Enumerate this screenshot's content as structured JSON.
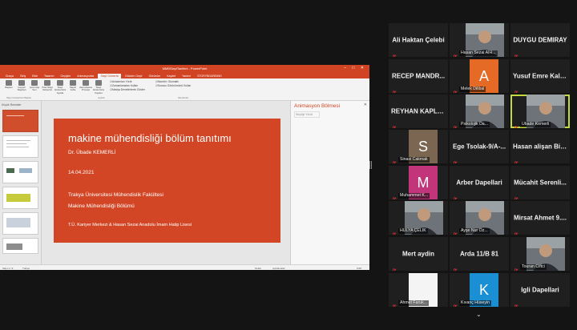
{
  "app": {
    "title": "MMBSlaytTanitimi - PowerPoint",
    "tabs": [
      "Dosya",
      "Giriş",
      "Ekle",
      "Tasarım",
      "Geçişler",
      "Animasyonlar",
      "Slayt Gösterisi",
      "Gözden Geçir",
      "Görünüm",
      "Kaydet",
      "Yardım",
      "STORYBOARDING"
    ],
    "active_tab": "Slayt Gösterisi",
    "search": "Ne yapmak istediğinizi söyleyin",
    "user": "Cihanno Ay",
    "share": "Paylaş"
  },
  "ribbon": {
    "buttons": [
      "Baştan",
      "Geçerli Slayttan",
      "Çevrimiçi Sun",
      "Özel Slayt Gösterisi",
      "Slayt Gösterisini Ayarla",
      "Slaydı Gizle",
      "Zamanlama Provası",
      "Slayt Gösterisini Kaydet"
    ],
    "checks": [
      "Anlatımları Yürüt",
      "Zamanlamaları Kullan",
      "Medya Denetimlerini Göster"
    ],
    "monitor": [
      "Monitör: Otomatik",
      "Sunucu Görünümünü Kullan"
    ],
    "groups": [
      "Slayt Gösterisini Başlat",
      "Ayarla",
      "Monitörler"
    ]
  },
  "thumbs_header": "Küçük Resimler",
  "slide": {
    "title": "makine mühendisliği bölüm tanıtımı",
    "author": "Dr. Übade KEMERLİ",
    "date": "14.04.2021",
    "institution": "Trakya Üniversitesi Mühendislik Fakültesi",
    "department": "Makine Mühendisliği Bölümü",
    "org": "T.Ü. Kariyer Merkezi & Hasan Sezai Anadolu İmam Hatip Lisesi"
  },
  "animation_pane": {
    "title": "Animasyon Bölmesi",
    "play": "Seçiliyi Yürüt"
  },
  "status": {
    "slide": "Slayt 1 / 9",
    "lang": "Türkçe",
    "notes": "Notlar",
    "comments": "Açıklamalar",
    "zoom": "%48"
  },
  "colors": {
    "accent": "#d04423",
    "speaker_outline": "#c4d93c",
    "background": "#141414"
  },
  "participants": [
    {
      "name": "Ali Haktan Çelebi",
      "kind": "name"
    },
    {
      "name": "Hasan Sezai AİH...",
      "kind": "video"
    },
    {
      "name": "DUYGU DEMIRAY",
      "kind": "name"
    },
    {
      "name": "RECEP MANDR...",
      "kind": "name"
    },
    {
      "name": "Melek Dilibal",
      "kind": "avatar",
      "initial": "A",
      "color": "#e46a25"
    },
    {
      "name": "Yusuf Emre Kalk...",
      "kind": "name"
    },
    {
      "name": "REYHAN KAPLAN",
      "kind": "name"
    },
    {
      "name": "Psikolojik Da...",
      "kind": "video"
    },
    {
      "name": "Übade Kemerli",
      "kind": "video",
      "speaking": true
    },
    {
      "name": "Sinasi Cakmak",
      "kind": "avatar",
      "initial": "S",
      "color": "#7b6651"
    },
    {
      "name": "Ege Tsolak-9/A-...",
      "kind": "name"
    },
    {
      "name": "Hasan alişan Bil...",
      "kind": "name"
    },
    {
      "name": "Muhammet K...",
      "kind": "avatar",
      "initial": "M",
      "color": "#c3357a"
    },
    {
      "name": "Arber Dapellari",
      "kind": "name"
    },
    {
      "name": "Mücahit Serenli...",
      "kind": "name"
    },
    {
      "name": "HULYA ÇELİK",
      "kind": "video"
    },
    {
      "name": "Ayşe Nur Öz...",
      "kind": "video"
    },
    {
      "name": "Mirsat Ahmet 9....",
      "kind": "name"
    },
    {
      "name": "Mert aydin",
      "kind": "name"
    },
    {
      "name": "Arda 11/B 81",
      "kind": "name"
    },
    {
      "name": "Touran Ciftci",
      "kind": "video"
    },
    {
      "name": "Ahmet Faruk...",
      "kind": "avatar",
      "initial": "",
      "color": "#f4f4f4"
    },
    {
      "name": "Kıvanç Hüseyin",
      "kind": "avatar",
      "initial": "K",
      "color": "#1a8fd4"
    },
    {
      "name": "Igli Dapellari",
      "kind": "name"
    }
  ]
}
